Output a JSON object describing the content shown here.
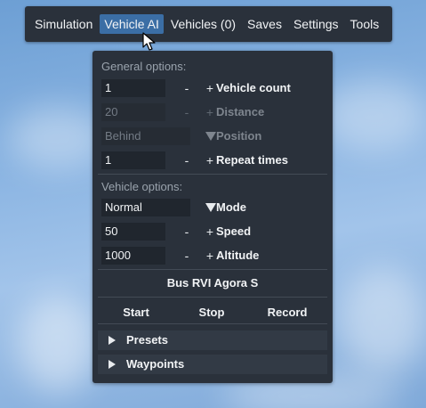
{
  "menubar": {
    "items": [
      "Simulation",
      "Vehicle AI",
      "Vehicles (0)",
      "Saves",
      "Settings",
      "Tools"
    ],
    "active": "Vehicle AI"
  },
  "general": {
    "heading": "General options:",
    "vehicle_count": {
      "value": "1",
      "minus": "-",
      "plus": "+",
      "label": "Vehicle count"
    },
    "distance": {
      "value": "20",
      "minus": "-",
      "plus": "+",
      "label": "Distance",
      "disabled": true
    },
    "position": {
      "value": "Behind",
      "label": "Position",
      "disabled": true
    },
    "repeat_times": {
      "value": "1",
      "minus": "-",
      "plus": "+",
      "label": "Repeat times"
    }
  },
  "vehicle": {
    "heading": "Vehicle options:",
    "mode": {
      "value": "Normal",
      "label": "Mode"
    },
    "speed": {
      "value": "50",
      "minus": "-",
      "plus": "+",
      "label": "Speed"
    },
    "altitude": {
      "value": "1000",
      "minus": "-",
      "plus": "+",
      "label": "Altitude"
    },
    "name": "Bus RVI Agora S"
  },
  "actions": {
    "start": "Start",
    "stop": "Stop",
    "record": "Record"
  },
  "sections": {
    "presets": "Presets",
    "waypoints": "Waypoints"
  },
  "colors": {
    "panel_bg": "#2a313b",
    "active_menu": "#3b6ea5",
    "field_bg": "#20262e"
  },
  "icons": {
    "dropdown": "triangle-down-icon",
    "collapse": "triangle-right-icon",
    "cursor": "mouse-pointer-icon"
  }
}
